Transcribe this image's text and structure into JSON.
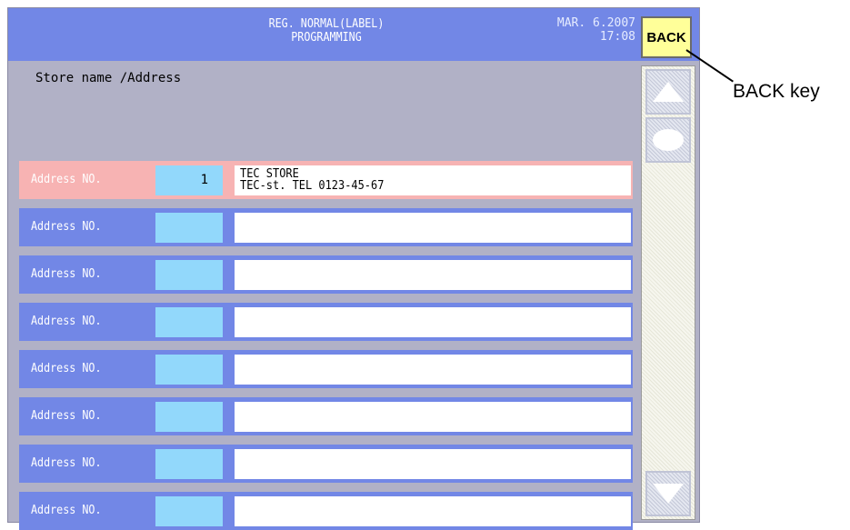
{
  "header": {
    "title_line1": "REG. NORMAL(LABEL)",
    "title_line2": "PROGRAMMING",
    "date": "MAR. 6.2007",
    "time": "17:08",
    "back_label": "BACK"
  },
  "section_title": "Store name /Address",
  "rows": [
    {
      "label": "Address NO.",
      "number": "1",
      "line1": "TEC STORE",
      "line2": "TEC-st. TEL 0123-45-67",
      "selected": true
    },
    {
      "label": "Address NO.",
      "number": "",
      "line1": "",
      "line2": ""
    },
    {
      "label": "Address NO.",
      "number": "",
      "line1": "",
      "line2": ""
    },
    {
      "label": "Address NO.",
      "number": "",
      "line1": "",
      "line2": ""
    },
    {
      "label": "Address NO.",
      "number": "",
      "line1": "",
      "line2": ""
    },
    {
      "label": "Address NO.",
      "number": "",
      "line1": "",
      "line2": ""
    },
    {
      "label": "Address NO.",
      "number": "",
      "line1": "",
      "line2": ""
    },
    {
      "label": "Address NO.",
      "number": "",
      "line1": "",
      "line2": ""
    }
  ],
  "scrollbar": {
    "up_icon": "triangle-up-icon",
    "thumb_icon": "oval-icon",
    "down_icon": "triangle-down-icon"
  },
  "callout": {
    "label": "BACK key"
  },
  "colors": {
    "header": "#7287e6",
    "row": "#7287e6",
    "row_selected": "#f7b3b3",
    "number_field": "#92d8fb",
    "back_button": "#ffff99",
    "screen_background": "#b1b1c6"
  }
}
